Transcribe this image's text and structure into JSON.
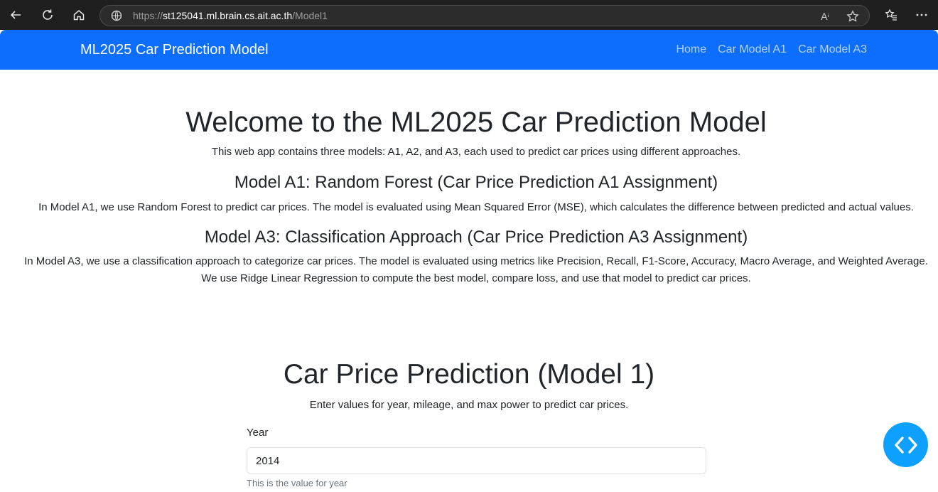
{
  "browser": {
    "url_scheme": "https://",
    "url_host": "st125041.ml.brain.cs.ait.ac.th",
    "url_path": "/Model1",
    "read_aloud_label": "A"
  },
  "navbar": {
    "brand": "ML2025 Car Prediction Model",
    "links": [
      "Home",
      "Car Model A1",
      "Car Model A3"
    ]
  },
  "intro": {
    "title": "Welcome to the ML2025 Car Prediction Model",
    "description": "This web app contains three models: A1, A2, and A3, each used to predict car prices using different approaches.",
    "a1_title": "Model A1: Random Forest (Car Price Prediction A1 Assignment)",
    "a1_text": "In Model A1, we use Random Forest to predict car prices. The model is evaluated using Mean Squared Error (MSE), which calculates the difference between predicted and actual values.",
    "a3_title": "Model A3: Classification Approach (Car Price Prediction A3 Assignment)",
    "a3_text_1": "In Model A3, we use a classification approach to categorize car prices. The model is evaluated using metrics like Precision, Recall, F1-Score, Accuracy, Macro Average, and Weighted Average.",
    "a3_text_2": "We use Ridge Linear Regression to compute the best model, compare loss, and use that model to predict car prices."
  },
  "form": {
    "title": "Car Price Prediction (Model 1)",
    "subtitle": "Enter values for year, mileage, and max power to predict car prices.",
    "year_label": "Year",
    "year_value": "2014",
    "year_help": "This is the value for year"
  },
  "colors": {
    "navbar": "#0d6efd",
    "fab": "#0ea0ff",
    "chrome": "#1f1f1f"
  },
  "icons": {
    "fab": "code-brackets-icon"
  }
}
